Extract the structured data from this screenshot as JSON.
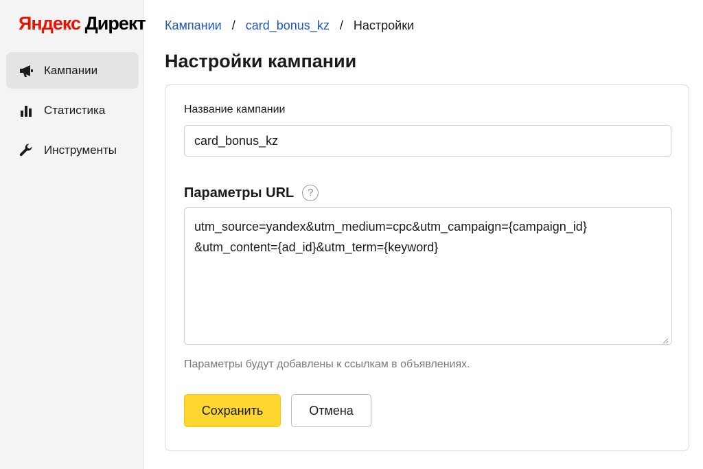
{
  "sidebar": {
    "logo_first": "Яндекс",
    "logo_second": "Директ",
    "items": [
      {
        "label": "Кампании",
        "icon": "megaphone-icon",
        "active": true
      },
      {
        "label": "Статистика",
        "icon": "bar-chart-icon",
        "active": false
      },
      {
        "label": "Инструменты",
        "icon": "wrench-icon",
        "active": false
      }
    ]
  },
  "breadcrumb": {
    "items": [
      "Кампании",
      "card_bonus_kz"
    ],
    "separator": "/",
    "current": "Настройки"
  },
  "page": {
    "title": "Настройки кампании"
  },
  "form": {
    "campaign_name_label": "Название кампании",
    "campaign_name_value": "card_bonus_kz",
    "url_params_title": "Параметры URL",
    "help_symbol": "?",
    "url_params_value": "utm_source=yandex&utm_medium=cpc&utm_campaign={campaign_id}\n&utm_content={ad_id}&utm_term={keyword}",
    "hint": "Параметры будут добавлены к ссылкам в объявлениях.",
    "save_label": "Сохранить",
    "cancel_label": "Отмена"
  },
  "colors": {
    "logo_accent": "#e61400",
    "link": "#1f57c3",
    "primary_button": "#fdd730",
    "sidebar_bg": "#f4f4f4",
    "active_item_bg": "#e4e4e4"
  }
}
